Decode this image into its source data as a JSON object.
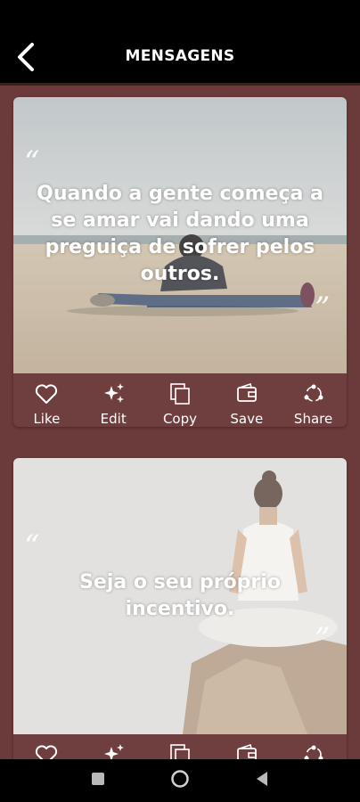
{
  "header": {
    "title": "MENSAGENS",
    "back_icon": "chevron-left-icon"
  },
  "cards": [
    {
      "quote": "Quando a gente começa a se amar vai dando uma preguiça de sofrer pelos outros.",
      "open_mark": "“",
      "close_mark": "”",
      "image": "person-sitting-stretching-on-beach"
    },
    {
      "quote": "Seja o seu próprio incentivo.",
      "open_mark": "“",
      "close_mark": "”",
      "image": "woman-meditating-on-rock"
    }
  ],
  "actions": {
    "like": "Like",
    "edit": "Edit",
    "copy": "Copy",
    "save": "Save",
    "share": "Share"
  },
  "colors": {
    "background": "#6b3a3b",
    "card": "#6f3e3f",
    "top_bar": "#000000",
    "text": "#ffffff"
  },
  "nav": {
    "recent": "square-icon",
    "home": "circle-icon",
    "back": "triangle-back-icon"
  }
}
